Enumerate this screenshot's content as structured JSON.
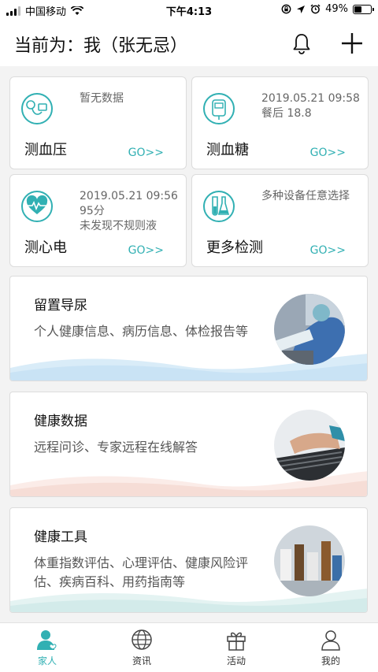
{
  "status_bar": {
    "carrier": "中国移动",
    "time": "下午4:13",
    "battery": "49%",
    "battery_level": 0.49
  },
  "header": {
    "title": "当前为：我（张无忌）"
  },
  "tiles": [
    {
      "name": "测血压",
      "go": "GO>>",
      "info_lines": [
        "暂无数据"
      ],
      "info_color": "gray"
    },
    {
      "name": "测血糖",
      "go": "GO>>",
      "info_lines": [
        "2019.05.21 09:58",
        "餐后 18.8"
      ],
      "info_color": "red"
    },
    {
      "name": "测心电",
      "go": "GO>>",
      "info_lines": [
        "2019.05.21 09:56",
        "95分",
        "未发现不规则液"
      ],
      "info_color": "teal"
    },
    {
      "name": "更多检测",
      "go": "GO>>",
      "info_lines": [
        "多种设备任意选择"
      ],
      "info_color": "gray"
    }
  ],
  "feature_cards": [
    {
      "title": "留置导尿",
      "desc": "个人健康信息、病历信息、体检报告等",
      "wave_color": "#d9ecf8"
    },
    {
      "title": "健康数据",
      "desc": "远程问诊、专家远程在线解答",
      "wave_color": "#f9e2dc"
    },
    {
      "title": "健康工具",
      "desc": "体重指数评估、心理评估、健康风险评估、疾病百科、用药指南等",
      "wave_color": "#dcefee"
    }
  ],
  "tabs": [
    {
      "label": "家人",
      "active": true
    },
    {
      "label": "资讯",
      "active": false
    },
    {
      "label": "活动",
      "active": false
    },
    {
      "label": "我的",
      "active": false
    }
  ],
  "colors": {
    "accent": "#31b0b3",
    "alert": "#e0453a"
  }
}
